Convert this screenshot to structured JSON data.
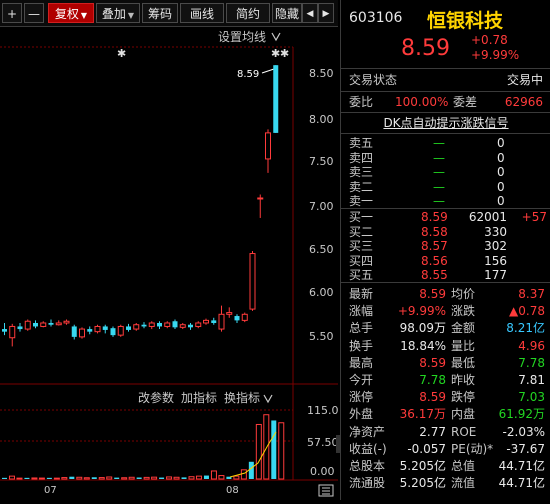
{
  "toolbar": {
    "plus": "+",
    "minus": "—",
    "fuquan": "复权",
    "diejia": "叠加",
    "chouma": "筹码",
    "huaxian": "画线",
    "jianyue": "简约",
    "yincang": "隐藏",
    "nav_left": "◀",
    "nav_right": "▶"
  },
  "chart": {
    "ma_setting": "设置均线",
    "price_axis": [
      "8.50",
      "8.00",
      "7.50",
      "7.00",
      "6.50",
      "6.00",
      "5.50"
    ],
    "high_label": "8.59",
    "star": "✱",
    "indicator_buttons": [
      "改参数",
      "加指标",
      "换指标"
    ],
    "vol_axis": [
      "115.00",
      "57.50",
      "0.00"
    ],
    "x_labels": [
      "07",
      "08"
    ],
    "candles": [
      {
        "o": 5.55,
        "c": 5.52,
        "h": 5.62,
        "l": 5.48
      },
      {
        "o": 5.45,
        "c": 5.58,
        "h": 5.61,
        "l": 5.35
      },
      {
        "o": 5.58,
        "c": 5.55,
        "h": 5.62,
        "l": 5.52
      },
      {
        "o": 5.55,
        "c": 5.64,
        "h": 5.66,
        "l": 5.53
      },
      {
        "o": 5.62,
        "c": 5.58,
        "h": 5.65,
        "l": 5.56
      },
      {
        "o": 5.58,
        "c": 5.62,
        "h": 5.64,
        "l": 5.57
      },
      {
        "o": 5.62,
        "c": 5.6,
        "h": 5.66,
        "l": 5.58
      },
      {
        "o": 5.6,
        "c": 5.62,
        "h": 5.65,
        "l": 5.59
      },
      {
        "o": 5.62,
        "c": 5.64,
        "h": 5.66,
        "l": 5.6
      },
      {
        "o": 5.58,
        "c": 5.46,
        "h": 5.6,
        "l": 5.43
      },
      {
        "o": 5.46,
        "c": 5.55,
        "h": 5.57,
        "l": 5.44
      },
      {
        "o": 5.55,
        "c": 5.52,
        "h": 5.58,
        "l": 5.49
      },
      {
        "o": 5.52,
        "c": 5.58,
        "h": 5.6,
        "l": 5.5
      },
      {
        "o": 5.58,
        "c": 5.54,
        "h": 5.6,
        "l": 5.5
      },
      {
        "o": 5.56,
        "c": 5.48,
        "h": 5.58,
        "l": 5.46
      },
      {
        "o": 5.48,
        "c": 5.58,
        "h": 5.6,
        "l": 5.46
      },
      {
        "o": 5.58,
        "c": 5.54,
        "h": 5.61,
        "l": 5.52
      },
      {
        "o": 5.55,
        "c": 5.6,
        "h": 5.62,
        "l": 5.53
      },
      {
        "o": 5.6,
        "c": 5.58,
        "h": 5.63,
        "l": 5.56
      },
      {
        "o": 5.58,
        "c": 5.62,
        "h": 5.64,
        "l": 5.55
      },
      {
        "o": 5.62,
        "c": 5.58,
        "h": 5.64,
        "l": 5.55
      },
      {
        "o": 5.58,
        "c": 5.62,
        "h": 5.64,
        "l": 5.56
      },
      {
        "o": 5.64,
        "c": 5.57,
        "h": 5.66,
        "l": 5.55
      },
      {
        "o": 5.57,
        "c": 5.6,
        "h": 5.62,
        "l": 5.55
      },
      {
        "o": 5.6,
        "c": 5.57,
        "h": 5.62,
        "l": 5.54
      },
      {
        "o": 5.58,
        "c": 5.62,
        "h": 5.64,
        "l": 5.56
      },
      {
        "o": 5.62,
        "c": 5.65,
        "h": 5.67,
        "l": 5.6
      },
      {
        "o": 5.65,
        "c": 5.62,
        "h": 5.68,
        "l": 5.6
      },
      {
        "o": 5.55,
        "c": 5.72,
        "h": 5.82,
        "l": 5.52
      },
      {
        "o": 5.72,
        "c": 5.74,
        "h": 5.8,
        "l": 5.68
      },
      {
        "o": 5.7,
        "c": 5.65,
        "h": 5.72,
        "l": 5.62
      },
      {
        "o": 5.65,
        "c": 5.72,
        "h": 5.74,
        "l": 5.63
      },
      {
        "o": 5.78,
        "c": 6.42,
        "h": 6.45,
        "l": 5.76
      },
      {
        "o": 7.06,
        "c": 7.06,
        "h": 7.1,
        "l": 6.83
      },
      {
        "o": 7.51,
        "c": 7.81,
        "h": 7.85,
        "l": 7.35
      },
      {
        "o": 8.59,
        "c": 7.81,
        "h": 8.59,
        "l": 7.81
      }
    ],
    "volumes": [
      2,
      5,
      1.5,
      2,
      1.8,
      1.6,
      2,
      1.5,
      2.5,
      4,
      3,
      2.2,
      3,
      2.5,
      3.5,
      2.4,
      2.2,
      3,
      2.6,
      2.8,
      3.2,
      2.5,
      3.6,
      3,
      2.8,
      4,
      5,
      6,
      14,
      6,
      4,
      5,
      16,
      30,
      95,
      112,
      102,
      98
    ]
  },
  "stock": {
    "code": "603106",
    "name": "恒银科技",
    "price": "8.59",
    "change": "+0.78",
    "change_pct": "+9.99%"
  },
  "status": {
    "label": "交易状态",
    "value": "交易中"
  },
  "weibi": {
    "label1": "委比",
    "value1": "100.00%",
    "label2": "委差",
    "value2": "62966"
  },
  "dk_signal": "DK点自动提示涨跌信号",
  "sell_orders": [
    {
      "label": "卖五",
      "price": "—",
      "vol": "0"
    },
    {
      "label": "卖四",
      "price": "—",
      "vol": "0"
    },
    {
      "label": "卖三",
      "price": "—",
      "vol": "0"
    },
    {
      "label": "卖二",
      "price": "—",
      "vol": "0"
    },
    {
      "label": "卖一",
      "price": "—",
      "vol": "0"
    }
  ],
  "buy_orders": [
    {
      "label": "买一",
      "price": "8.59",
      "vol": "62001",
      "delta": "+57"
    },
    {
      "label": "买二",
      "price": "8.58",
      "vol": "330",
      "delta": ""
    },
    {
      "label": "买三",
      "price": "8.57",
      "vol": "302",
      "delta": ""
    },
    {
      "label": "买四",
      "price": "8.56",
      "vol": "156",
      "delta": ""
    },
    {
      "label": "买五",
      "price": "8.55",
      "vol": "177",
      "delta": ""
    }
  ],
  "stats": [
    {
      "l1": "最新",
      "v1": "8.59",
      "c1": "red",
      "l2": "均价",
      "v2": "8.37",
      "c2": "red"
    },
    {
      "l1": "涨幅",
      "v1": "+9.99%",
      "c1": "red",
      "l2": "涨跌",
      "v2": "▲0.78",
      "c2": "red"
    },
    {
      "l1": "总手",
      "v1": "98.09万",
      "c1": "white",
      "l2": "金额",
      "v2": "8.21亿",
      "c2": "cyan"
    },
    {
      "l1": "换手",
      "v1": "18.84%",
      "c1": "white",
      "l2": "量比",
      "v2": "4.96",
      "c2": "red"
    },
    {
      "l1": "最高",
      "v1": "8.59",
      "c1": "red",
      "l2": "最低",
      "v2": "7.78",
      "c2": "green"
    },
    {
      "l1": "今开",
      "v1": "7.78",
      "c1": "green",
      "l2": "昨收",
      "v2": "7.81",
      "c2": "white"
    },
    {
      "l1": "涨停",
      "v1": "8.59",
      "c1": "red",
      "l2": "跌停",
      "v2": "7.03",
      "c2": "green"
    },
    {
      "l1": "外盘",
      "v1": "36.17万",
      "c1": "red",
      "l2": "内盘",
      "v2": "61.92万",
      "c2": "green"
    },
    {
      "l1": "净资产",
      "v1": "2.77",
      "c1": "white",
      "l2": "ROE",
      "v2": "-2.03%",
      "c2": "white"
    },
    {
      "l1": "收益(-)",
      "v1": "-0.057",
      "c1": "white",
      "l2": "PE(动)*",
      "v2": "-37.67",
      "c2": "white"
    },
    {
      "l1": "总股本",
      "v1": "5.205亿",
      "c1": "white",
      "l2": "总值",
      "v2": "44.71亿",
      "c2": "white"
    },
    {
      "l1": "流通股",
      "v1": "5.205亿",
      "c1": "white",
      "l2": "流值",
      "v2": "44.71亿",
      "c2": "white"
    }
  ]
}
